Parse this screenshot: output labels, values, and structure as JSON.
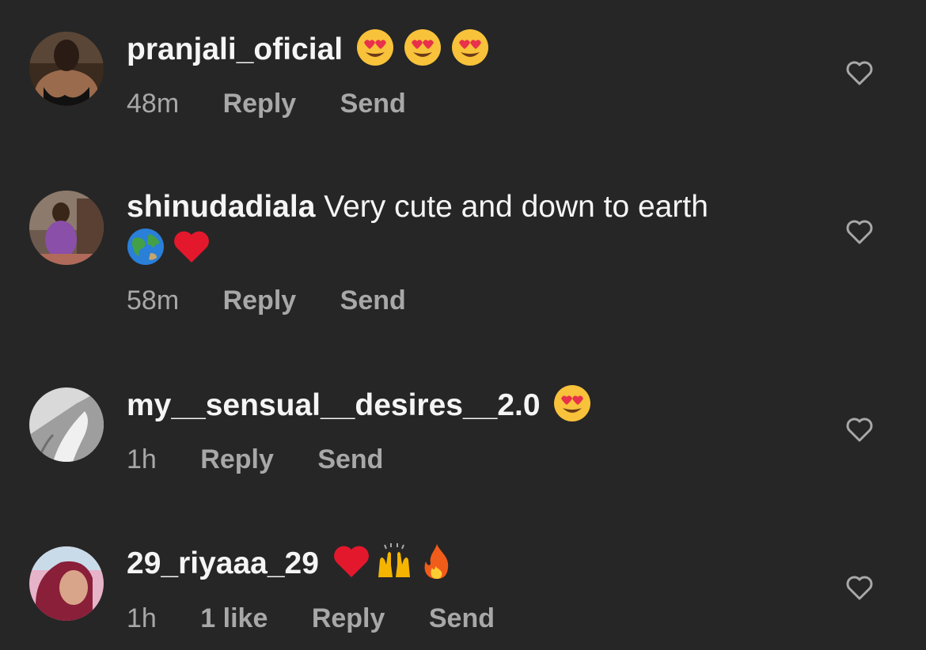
{
  "comments": [
    {
      "username": "pranjali_oficial",
      "text": "",
      "emojis": [
        "heart-eyes-emoji",
        "heart-eyes-emoji",
        "heart-eyes-emoji"
      ],
      "time": "48m",
      "likes": "",
      "reply_label": "Reply",
      "send_label": "Send"
    },
    {
      "username": "shinudadiala",
      "text": "Very cute and down to earth",
      "emojis": [
        "globe-emoji",
        "red-heart-emoji"
      ],
      "time": "58m",
      "likes": "",
      "reply_label": "Reply",
      "send_label": "Send"
    },
    {
      "username": "my__sensual__desires__2.0",
      "text": "",
      "emojis": [
        "heart-eyes-emoji"
      ],
      "time": "1h",
      "likes": "",
      "reply_label": "Reply",
      "send_label": "Send"
    },
    {
      "username": "29_riyaaa_29",
      "text": "",
      "emojis": [
        "red-heart-emoji",
        "raising-hands-emoji",
        "fire-emoji"
      ],
      "time": "1h",
      "likes": "1 like",
      "reply_label": "Reply",
      "send_label": "Send"
    }
  ],
  "colors": {
    "background": "#262626",
    "primary_text": "#f5f5f5",
    "secondary_text": "#a8a8a8"
  }
}
